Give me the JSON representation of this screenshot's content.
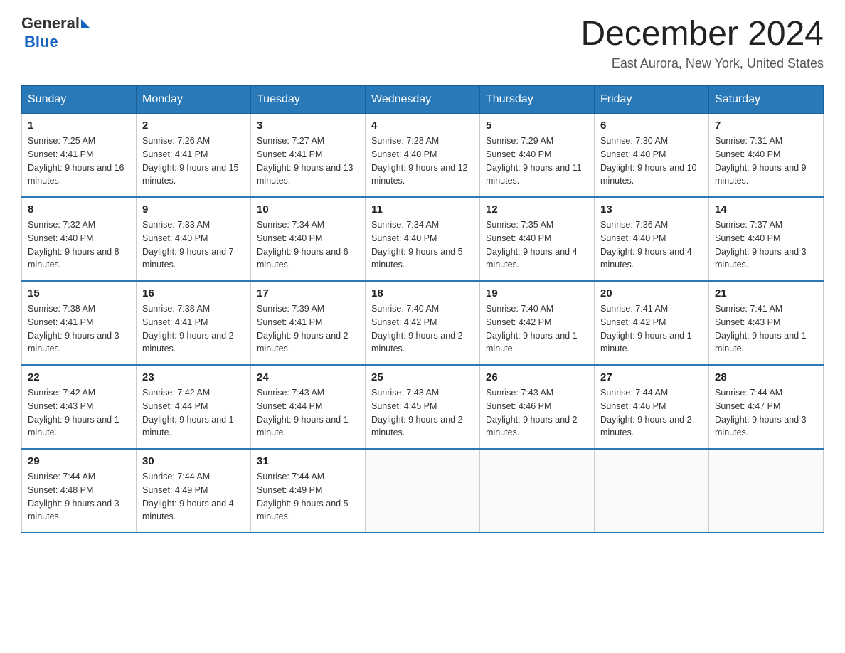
{
  "header": {
    "title": "December 2024",
    "subtitle": "East Aurora, New York, United States",
    "logo": {
      "general": "General",
      "blue": "Blue"
    }
  },
  "days": [
    "Sunday",
    "Monday",
    "Tuesday",
    "Wednesday",
    "Thursday",
    "Friday",
    "Saturday"
  ],
  "weeks": [
    [
      {
        "date": "1",
        "sunrise": "7:25 AM",
        "sunset": "4:41 PM",
        "daylight": "9 hours and 16 minutes."
      },
      {
        "date": "2",
        "sunrise": "7:26 AM",
        "sunset": "4:41 PM",
        "daylight": "9 hours and 15 minutes."
      },
      {
        "date": "3",
        "sunrise": "7:27 AM",
        "sunset": "4:41 PM",
        "daylight": "9 hours and 13 minutes."
      },
      {
        "date": "4",
        "sunrise": "7:28 AM",
        "sunset": "4:40 PM",
        "daylight": "9 hours and 12 minutes."
      },
      {
        "date": "5",
        "sunrise": "7:29 AM",
        "sunset": "4:40 PM",
        "daylight": "9 hours and 11 minutes."
      },
      {
        "date": "6",
        "sunrise": "7:30 AM",
        "sunset": "4:40 PM",
        "daylight": "9 hours and 10 minutes."
      },
      {
        "date": "7",
        "sunrise": "7:31 AM",
        "sunset": "4:40 PM",
        "daylight": "9 hours and 9 minutes."
      }
    ],
    [
      {
        "date": "8",
        "sunrise": "7:32 AM",
        "sunset": "4:40 PM",
        "daylight": "9 hours and 8 minutes."
      },
      {
        "date": "9",
        "sunrise": "7:33 AM",
        "sunset": "4:40 PM",
        "daylight": "9 hours and 7 minutes."
      },
      {
        "date": "10",
        "sunrise": "7:34 AM",
        "sunset": "4:40 PM",
        "daylight": "9 hours and 6 minutes."
      },
      {
        "date": "11",
        "sunrise": "7:34 AM",
        "sunset": "4:40 PM",
        "daylight": "9 hours and 5 minutes."
      },
      {
        "date": "12",
        "sunrise": "7:35 AM",
        "sunset": "4:40 PM",
        "daylight": "9 hours and 4 minutes."
      },
      {
        "date": "13",
        "sunrise": "7:36 AM",
        "sunset": "4:40 PM",
        "daylight": "9 hours and 4 minutes."
      },
      {
        "date": "14",
        "sunrise": "7:37 AM",
        "sunset": "4:40 PM",
        "daylight": "9 hours and 3 minutes."
      }
    ],
    [
      {
        "date": "15",
        "sunrise": "7:38 AM",
        "sunset": "4:41 PM",
        "daylight": "9 hours and 3 minutes."
      },
      {
        "date": "16",
        "sunrise": "7:38 AM",
        "sunset": "4:41 PM",
        "daylight": "9 hours and 2 minutes."
      },
      {
        "date": "17",
        "sunrise": "7:39 AM",
        "sunset": "4:41 PM",
        "daylight": "9 hours and 2 minutes."
      },
      {
        "date": "18",
        "sunrise": "7:40 AM",
        "sunset": "4:42 PM",
        "daylight": "9 hours and 2 minutes."
      },
      {
        "date": "19",
        "sunrise": "7:40 AM",
        "sunset": "4:42 PM",
        "daylight": "9 hours and 1 minute."
      },
      {
        "date": "20",
        "sunrise": "7:41 AM",
        "sunset": "4:42 PM",
        "daylight": "9 hours and 1 minute."
      },
      {
        "date": "21",
        "sunrise": "7:41 AM",
        "sunset": "4:43 PM",
        "daylight": "9 hours and 1 minute."
      }
    ],
    [
      {
        "date": "22",
        "sunrise": "7:42 AM",
        "sunset": "4:43 PM",
        "daylight": "9 hours and 1 minute."
      },
      {
        "date": "23",
        "sunrise": "7:42 AM",
        "sunset": "4:44 PM",
        "daylight": "9 hours and 1 minute."
      },
      {
        "date": "24",
        "sunrise": "7:43 AM",
        "sunset": "4:44 PM",
        "daylight": "9 hours and 1 minute."
      },
      {
        "date": "25",
        "sunrise": "7:43 AM",
        "sunset": "4:45 PM",
        "daylight": "9 hours and 2 minutes."
      },
      {
        "date": "26",
        "sunrise": "7:43 AM",
        "sunset": "4:46 PM",
        "daylight": "9 hours and 2 minutes."
      },
      {
        "date": "27",
        "sunrise": "7:44 AM",
        "sunset": "4:46 PM",
        "daylight": "9 hours and 2 minutes."
      },
      {
        "date": "28",
        "sunrise": "7:44 AM",
        "sunset": "4:47 PM",
        "daylight": "9 hours and 3 minutes."
      }
    ],
    [
      {
        "date": "29",
        "sunrise": "7:44 AM",
        "sunset": "4:48 PM",
        "daylight": "9 hours and 3 minutes."
      },
      {
        "date": "30",
        "sunrise": "7:44 AM",
        "sunset": "4:49 PM",
        "daylight": "9 hours and 4 minutes."
      },
      {
        "date": "31",
        "sunrise": "7:44 AM",
        "sunset": "4:49 PM",
        "daylight": "9 hours and 5 minutes."
      },
      null,
      null,
      null,
      null
    ]
  ]
}
